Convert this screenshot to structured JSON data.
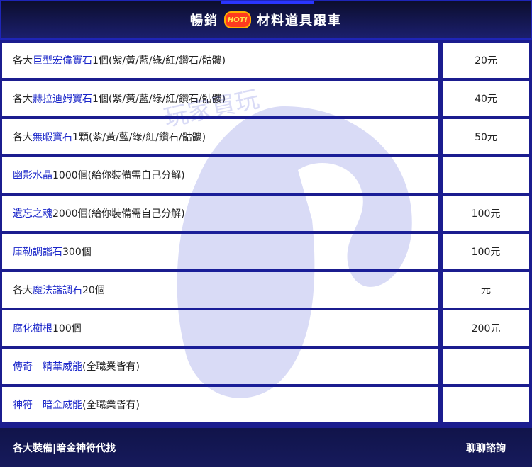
{
  "header": {
    "title_left": "暢銷",
    "badge": "HOT!",
    "title_right": "材料道具跟車"
  },
  "watermark_text": "玩家買玩",
  "items": [
    {
      "pre": "各大",
      "hl": "巨型宏偉寶石",
      "post": "1個(紫/黃/藍/綠/紅/鑽石/骷髏)",
      "price": "20元"
    },
    {
      "pre": "各大",
      "hl": "赫拉迪姆寶石",
      "post": "1個(紫/黃/藍/綠/紅/鑽石/骷髏)",
      "price": "40元"
    },
    {
      "pre": "各大",
      "hl": "無暇寶石",
      "post": "1顆(紫/黃/藍/綠/紅/鑽石/骷髏)",
      "price": "50元"
    },
    {
      "pre": "",
      "hl": "幽影水晶",
      "post": "1000個(給你裝備需自己分解)",
      "price": ""
    },
    {
      "pre": "",
      "hl": "遺忘之魂",
      "post": "2000個(給你裝備需自己分解)",
      "price": "100元"
    },
    {
      "pre": "",
      "hl": "庫勒調諧石",
      "post": "300個",
      "price": "100元"
    },
    {
      "pre": "各大",
      "hl": "魔法諧調石",
      "post": "20個",
      "price": "元"
    },
    {
      "pre": "",
      "hl": "腐化樹根",
      "post": "100個",
      "price": "200元"
    },
    {
      "pre": "",
      "hl": "傳奇　精華威能",
      "post": "(全職業皆有)",
      "price": ""
    },
    {
      "pre": "",
      "hl": "神符　暗金威能",
      "post": "(全職業皆有)",
      "price": ""
    }
  ],
  "footer": {
    "label": "各大裝備|暗金神符代找",
    "button": "聊聊諮詢"
  },
  "colors": {
    "accent": "#1a26c9",
    "border": "#1b1d8f",
    "hot": "#ff3b1f"
  }
}
